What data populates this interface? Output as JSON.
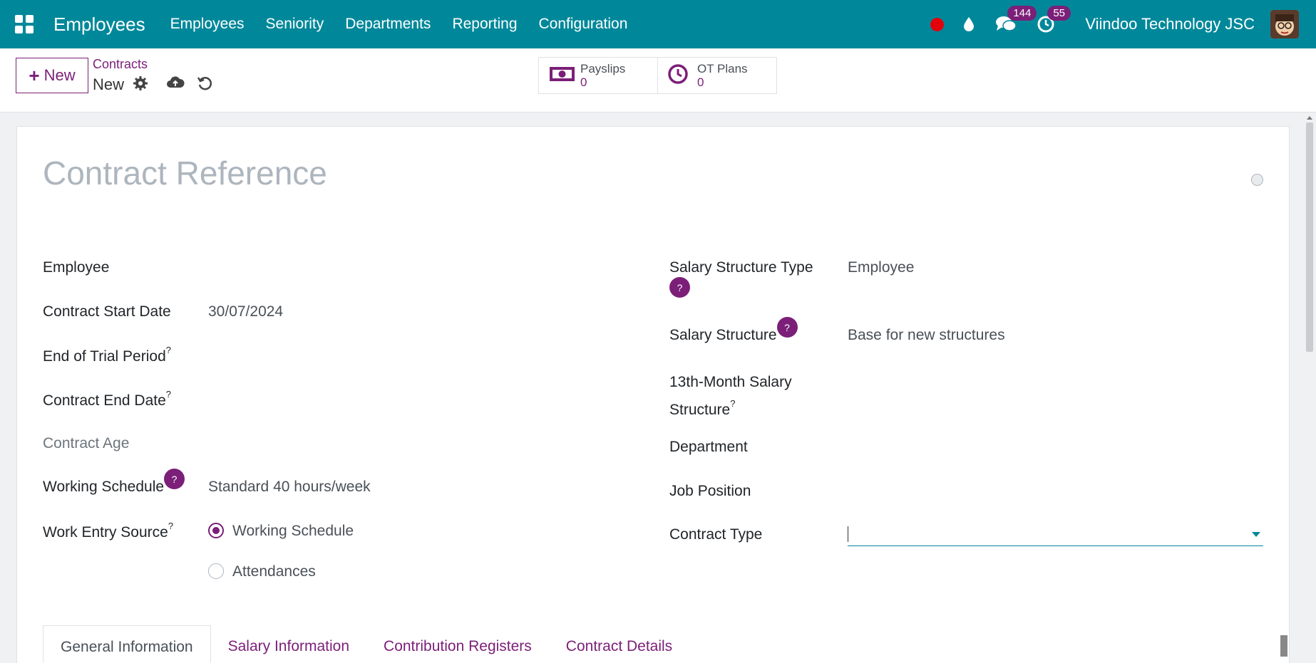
{
  "navbar": {
    "app_title": "Employees",
    "menu": [
      "Employees",
      "Seniority",
      "Departments",
      "Reporting",
      "Configuration"
    ],
    "messages_count": "144",
    "activities_count": "55",
    "company": "Viindoo Technology JSC",
    "accent_color": "#00889a",
    "badge_color": "#7b1f78",
    "record_color": "#e3000b"
  },
  "control": {
    "new_label": "New",
    "breadcrumb": "Contracts",
    "record_name": "New",
    "smart_buttons": [
      {
        "label": "Payslips",
        "value": "0",
        "icon": "money-icon"
      },
      {
        "label": "OT Plans",
        "value": "0",
        "icon": "clock-icon"
      }
    ]
  },
  "form": {
    "title_placeholder": "Contract Reference",
    "left": {
      "employee_label": "Employee",
      "start_date_label": "Contract Start Date",
      "start_date_value": "30/07/2024",
      "trial_label": "End of Trial Period",
      "end_date_label": "Contract End Date",
      "age_label": "Contract Age",
      "schedule_label": "Working Schedule",
      "schedule_value": "Standard 40 hours/week",
      "work_entry_label": "Work Entry Source",
      "work_entry_options": [
        "Working Schedule",
        "Attendances"
      ],
      "work_entry_selected": "Working Schedule"
    },
    "right": {
      "structure_type_label": "Salary Structure Type",
      "structure_type_value": "Employee",
      "structure_label": "Salary Structure",
      "structure_value": "Base for new structures",
      "thirteenth_label_1": "13th-Month Salary",
      "thirteenth_label_2": "Structure",
      "department_label": "Department",
      "job_label": "Job Position",
      "contract_type_label": "Contract Type",
      "contract_type_value": ""
    },
    "help_mark": "?",
    "tooltip_mark": "?"
  },
  "tabs": [
    "General Information",
    "Salary Information",
    "Contribution Registers",
    "Contract Details"
  ],
  "active_tab": "General Information"
}
